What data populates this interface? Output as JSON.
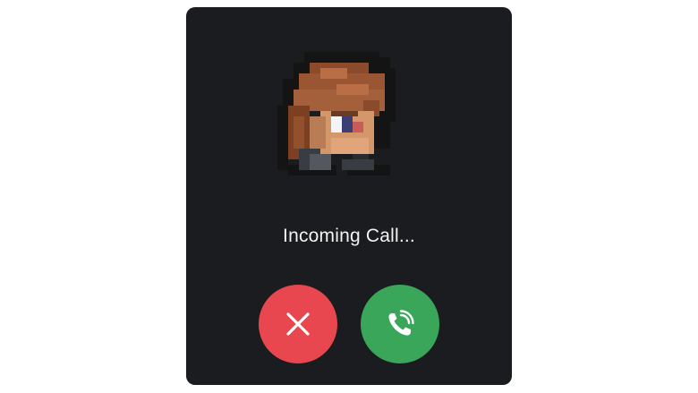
{
  "call": {
    "status": "Incoming Call..."
  },
  "avatar": {
    "icon": "pixel-art-character-portrait"
  },
  "actions": {
    "decline": {
      "icon": "close-icon",
      "color": "#e8474f"
    },
    "accept": {
      "icon": "phone-ringing-icon",
      "color": "#3aa65a"
    }
  },
  "colors": {
    "card_background": "#1b1c20",
    "page_background": "#ffffff",
    "text": "#f2f2f2"
  }
}
